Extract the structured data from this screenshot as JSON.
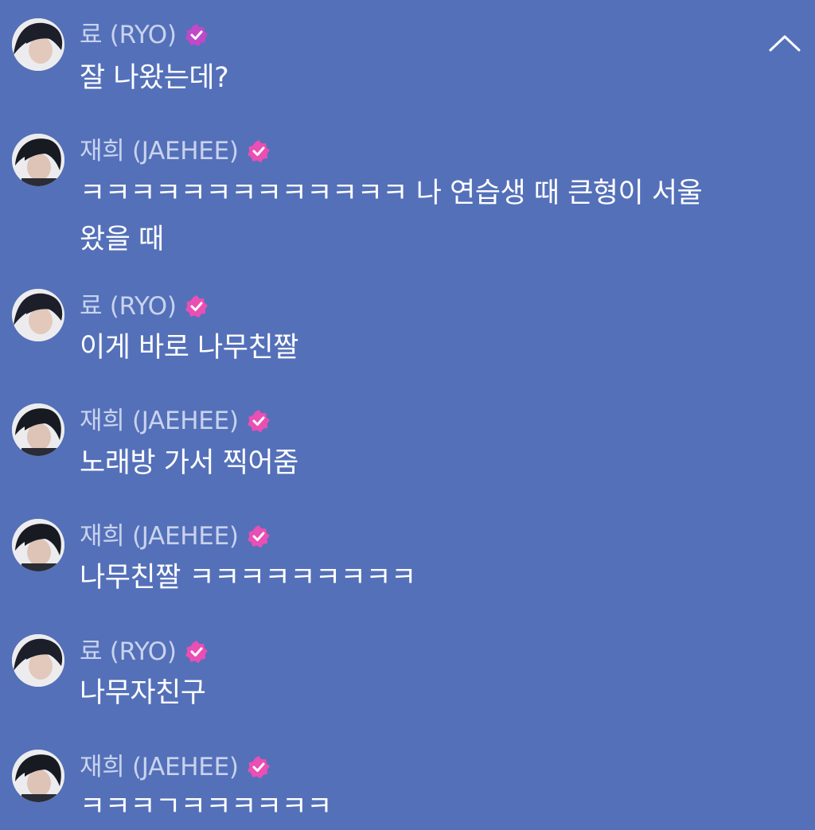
{
  "colors": {
    "background": "#5470b9",
    "name_text": "#c9d3ee",
    "message_text": "#ffffff",
    "verified_badge_ryo": "#c148c9",
    "verified_badge": "#e94fb4"
  },
  "header": {
    "collapse_icon": "chevron-up-icon"
  },
  "messages": [
    {
      "sender": "료 (RYO)",
      "text": "잘 나왔는데?",
      "badge_icon": "verified-badge-icon"
    },
    {
      "sender": "재희 (JAEHEE)",
      "text": "ㅋㅋㅋㅋㅋㅋㅋㅋㅋㅋㅋㅋㅋ 나 연습생 때 큰형이 서울\n왔을 때",
      "badge_icon": "verified-badge-icon"
    },
    {
      "sender": "료 (RYO)",
      "text": "이게 바로 나무친짤",
      "badge_icon": "verified-badge-icon"
    },
    {
      "sender": "재희 (JAEHEE)",
      "text": "노래방 가서 찍어줌",
      "badge_icon": "verified-badge-icon"
    },
    {
      "sender": "재희 (JAEHEE)",
      "text": "나무친짤 ㅋㅋㅋㅋㅋㅋㅋㅋㅋ",
      "badge_icon": "verified-badge-icon"
    },
    {
      "sender": "료 (RYO)",
      "text": "나무자친구",
      "badge_icon": "verified-badge-icon"
    },
    {
      "sender": "재희 (JAEHEE)",
      "text": "ㅋㅋㅋㄱㅋㅋㅋㅋㅋㅋ",
      "badge_icon": "verified-badge-icon"
    }
  ]
}
